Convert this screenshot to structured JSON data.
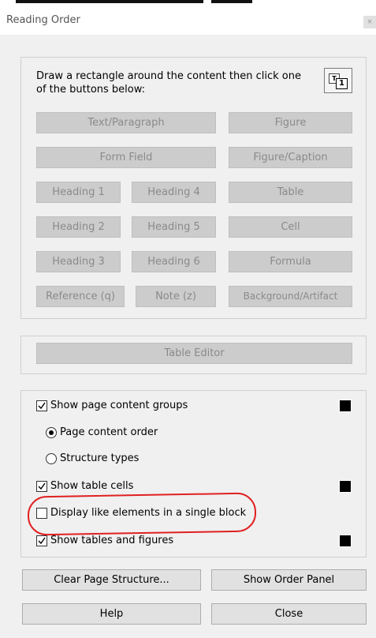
{
  "window": {
    "title": "Reading Order"
  },
  "tagging": {
    "instructions": "Draw a rectangle around the content then click one of the buttons below:",
    "dock_icon_label_back": "T",
    "dock_icon_label_front": "1",
    "buttons": {
      "text_paragraph": "Text/Paragraph",
      "figure": "Figure",
      "form_field": "Form Field",
      "figure_caption": "Figure/Caption",
      "heading1": "Heading 1",
      "heading4": "Heading 4",
      "table": "Table",
      "heading2": "Heading 2",
      "heading5": "Heading 5",
      "cell": "Cell",
      "heading3": "Heading 3",
      "heading6": "Heading 6",
      "formula": "Formula",
      "reference": "Reference (q)",
      "note": "Note (z)",
      "background_artifact": "Background/Artifact"
    }
  },
  "table_editor": {
    "label": "Table Editor"
  },
  "options": {
    "show_page_content_groups": {
      "label": "Show page content groups",
      "checked": true,
      "color": "#000000"
    },
    "page_content_order": {
      "label": "Page content order",
      "selected": true
    },
    "structure_types": {
      "label": "Structure types",
      "selected": false
    },
    "show_table_cells": {
      "label": "Show table cells",
      "checked": true,
      "color": "#000000"
    },
    "display_like_elements": {
      "label": "Display like elements in a single block",
      "checked": false
    },
    "show_tables_figures": {
      "label": "Show tables and figures",
      "checked": true,
      "color": "#000000"
    }
  },
  "footer": {
    "clear_page_structure": "Clear Page Structure...",
    "show_order_panel": "Show Order Panel",
    "help": "Help",
    "close": "Close"
  },
  "colors": {
    "annotation": "#e02020",
    "disabled_button": "#cccccc"
  }
}
